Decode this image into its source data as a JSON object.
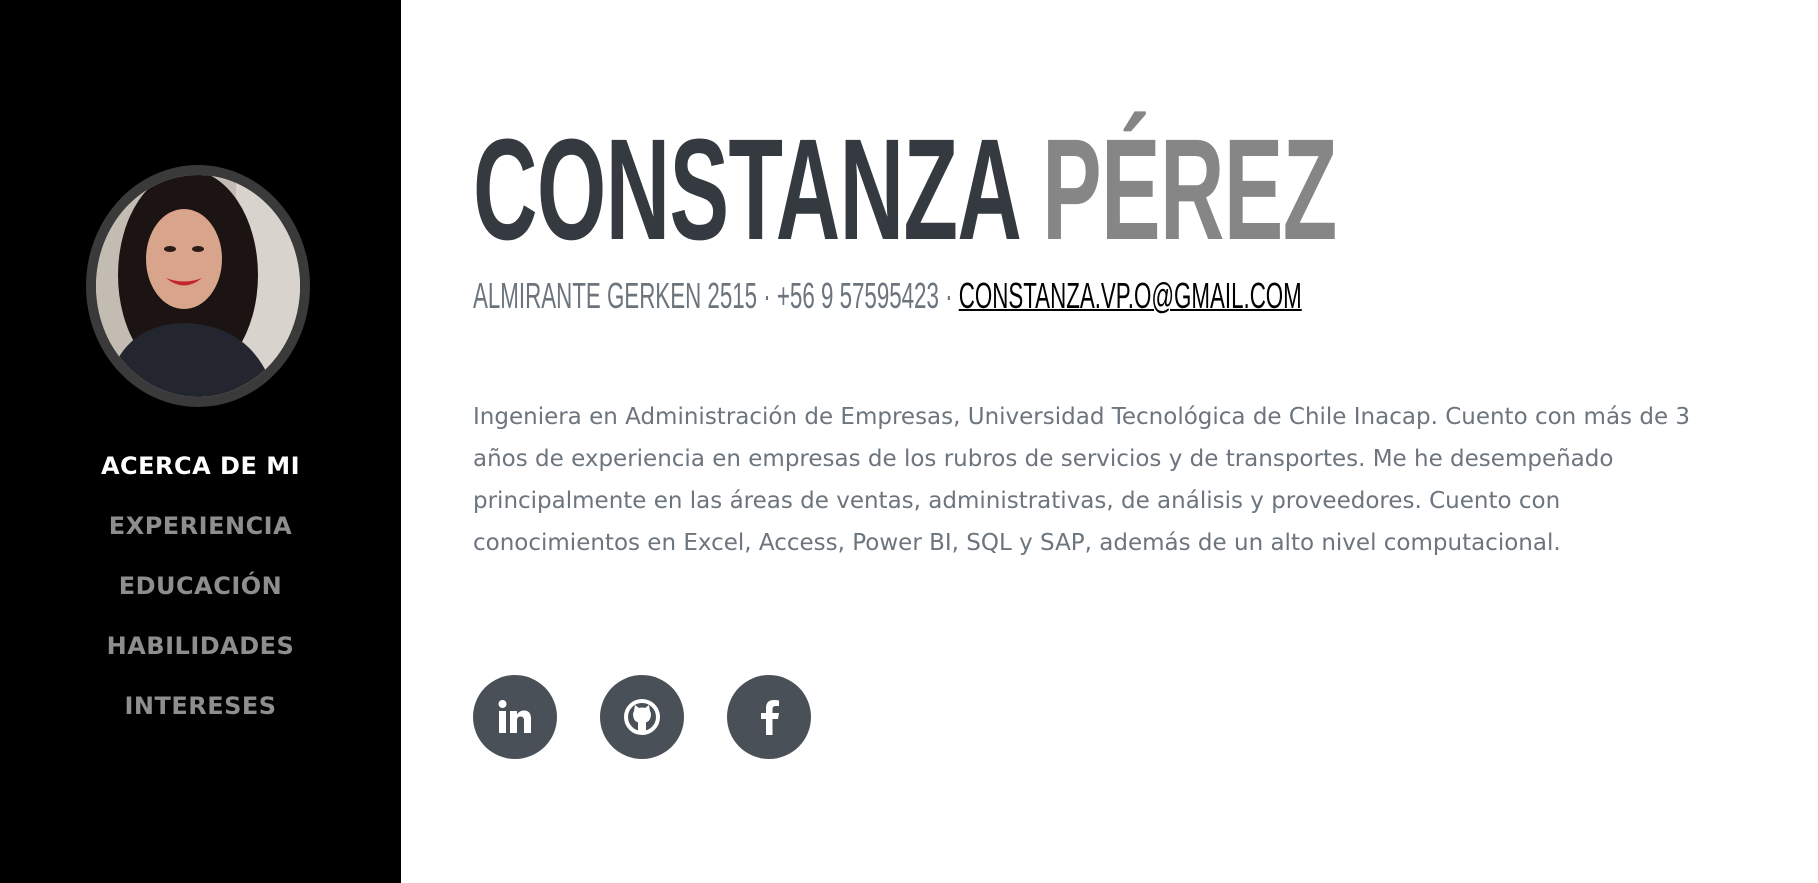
{
  "sidebar": {
    "nav": [
      {
        "label": "ACERCA DE MI",
        "active": true
      },
      {
        "label": "EXPERIENCIA",
        "active": false
      },
      {
        "label": "EDUCACIÓN",
        "active": false
      },
      {
        "label": "HABILIDADES",
        "active": false
      },
      {
        "label": "INTERESES",
        "active": false
      }
    ]
  },
  "header": {
    "first_name": "CONSTANZA",
    "last_name": "PÉREZ",
    "address": "ALMIRANTE GERKEN 2515",
    "separator": " · ",
    "phone": "+56 9 57595423",
    "email": "CONSTANZA.VP.O@GMAIL.COM"
  },
  "about": {
    "text": "Ingeniera en Administración de Empresas, Universidad Tecnológica de Chile Inacap. Cuento con más de 3 años de experiencia en empresas de los rubros de servicios y de transportes. Me he desempeñado principalmente en las áreas de ventas, administrativas, de análisis y proveedores. Cuento con conocimientos en Excel, Access, Power BI, SQL y SAP, además de un alto nivel computacional."
  },
  "socials": [
    {
      "icon": "linkedin-icon"
    },
    {
      "icon": "github-icon"
    },
    {
      "icon": "facebook-icon"
    }
  ],
  "colors": {
    "sidebar_bg": "#000000",
    "nav_active": "#ffffff",
    "nav_inactive": "#8e8e8e",
    "name_primary": "#343a40",
    "name_secondary": "#868686",
    "text_muted": "#6c757d",
    "social_bg": "#495057"
  }
}
